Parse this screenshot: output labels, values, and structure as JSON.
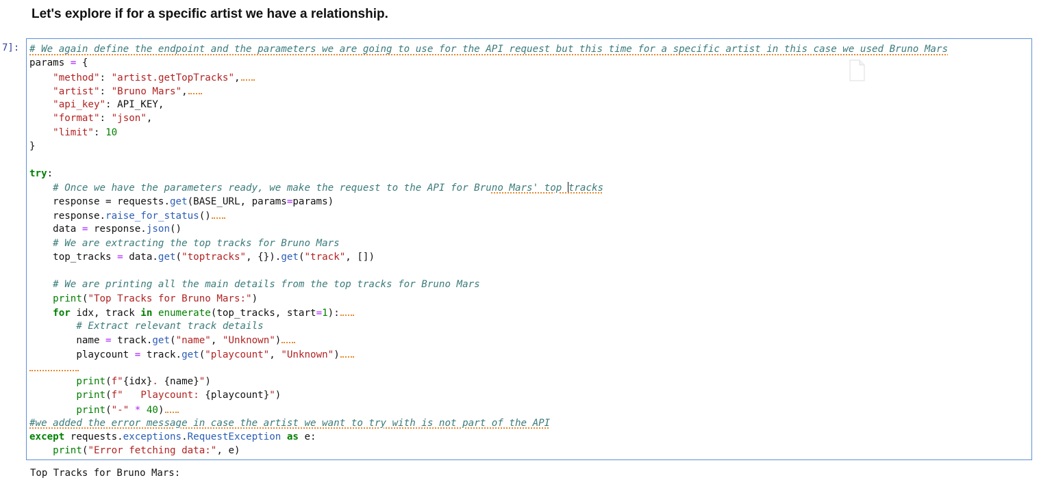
{
  "markdown": {
    "heading": "Let's explore if for a specific artist we have a relationship."
  },
  "cell": {
    "prompt": "7]:",
    "lines": {
      "l01": "# We again define the endpoint and the parameters we are going to use for the API request but this time for a specific artist in this case we used Bruno Mars",
      "l02a": "params ",
      "l02b": "=",
      "l02c": " {",
      "l03a": "    ",
      "l03b": "\"method\"",
      "l03c": ": ",
      "l03d": "\"artist.getTopTracks\"",
      "l03e": ",",
      "l04b": "\"artist\"",
      "l04c": ": ",
      "l04d": "\"Bruno Mars\"",
      "l04e": ",",
      "l05b": "\"api_key\"",
      "l05c": ": API_KEY,",
      "l06b": "\"format\"",
      "l06c": ": ",
      "l06d": "\"json\"",
      "l06e": ",",
      "l07b": "\"limit\"",
      "l07c": ": ",
      "l07d": "10",
      "l08": "}",
      "l10": "try",
      "l10b": ":",
      "l11a": "    ",
      "l11b": "# Once we have the parameters ready, we make the request to the API for Bru",
      "l11c": "no Mars' top ",
      "l11d": "tracks",
      "l12": "    response = requests.",
      "l12b": "get",
      "l12c": "(BASE_URL, params",
      "l12d": "=",
      "l12e": "params)",
      "l13a": "    response.",
      "l13b": "raise_for_status",
      "l13c": "()",
      "l14a": "    data ",
      "l14b": "=",
      "l14c": " response.",
      "l14d": "json",
      "l14e": "()",
      "l15": "# We are extracting the top tracks for Bruno Mars",
      "l16a": "    top_tracks ",
      "l16b": "=",
      "l16c": " data.",
      "l16d": "get",
      "l16e": "(",
      "l16f": "\"toptracks\"",
      "l16g": ", {}).",
      "l16h": "get",
      "l16i": "(",
      "l16j": "\"track\"",
      "l16k": ", [])",
      "l18": "# We are printing all the main details from the top tracks for Bruno Mars",
      "l19a": "print",
      "l19b": "(",
      "l19c": "\"Top Tracks for Bruno Mars:\"",
      "l19d": ")",
      "l20a": "for",
      "l20b": " idx, track ",
      "l20c": "in",
      "l20d": " ",
      "l20e": "enumerate",
      "l20f": "(top_tracks, start",
      "l20g": "=",
      "l20h": "1",
      "l20i": "):",
      "l21": "# Extract relevant track details",
      "l22a": "        name ",
      "l22b": "=",
      "l22c": " track.",
      "l22d": "get",
      "l22e": "(",
      "l22f": "\"name\"",
      "l22g": ", ",
      "l22h": "\"Unknown\"",
      "l22i": ")",
      "l23a": "        playcount ",
      "l23b": "=",
      "l23c": " track.",
      "l23d": "get",
      "l23e": "(",
      "l23f": "\"playcount\"",
      "l23g": ", ",
      "l23h": "\"Unknown\"",
      "l23i": ")",
      "l25a": "print",
      "l25b": "(",
      "l25c": "f\"",
      "l25d": "{idx}",
      "l25e": ". ",
      "l25f": "{name}",
      "l25g": "\"",
      "l25h": ")",
      "l26a": "print",
      "l26b": "(",
      "l26c": "f\"   Playcount: ",
      "l26d": "{playcount}",
      "l26e": "\"",
      "l26f": ")",
      "l27a": "print",
      "l27b": "(",
      "l27c": "\"-\"",
      "l27d": " ",
      "l27e": "*",
      "l27f": " ",
      "l27g": "40",
      "l27h": ")",
      "l28": "#we added the error message in case the artist we want to try with is not part of the API",
      "l29a": "except",
      "l29b": " requests.",
      "l29c": "exceptions",
      "l29d": ".",
      "l29e": "RequestException",
      "l29f": " ",
      "l29g": "as",
      "l29h": " e:",
      "l30a": "print",
      "l30b": "(",
      "l30c": "\"Error fetching data:\"",
      "l30d": ", e)"
    }
  },
  "output": {
    "first_line": "Top Tracks for Bruno Mars:"
  },
  "icons": {
    "file": "file-icon"
  },
  "colors": {
    "comment": "#3b7a7a",
    "string": "#b22222",
    "keyword": "#008000",
    "operator": "#aa22ff",
    "cell_border": "#5b8fd6",
    "prompt": "#303F9F"
  }
}
